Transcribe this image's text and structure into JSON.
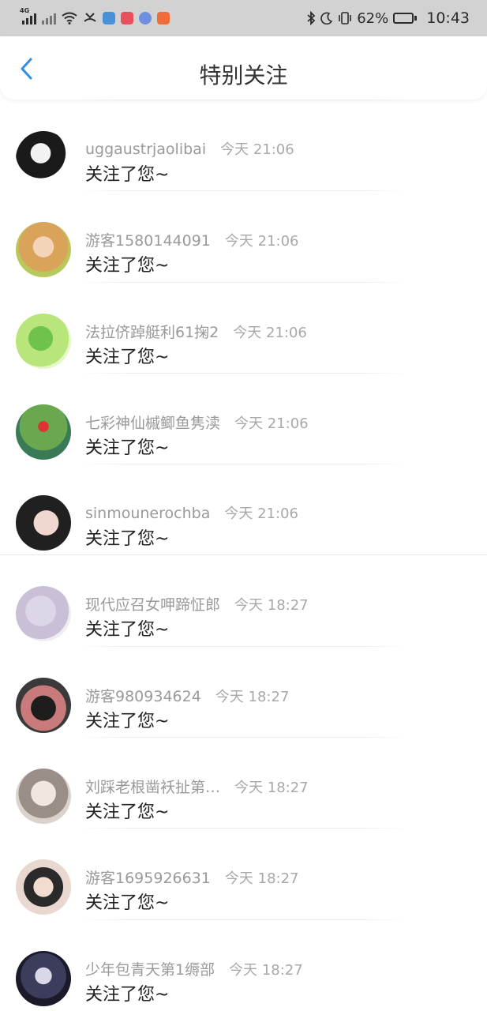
{
  "status_bar": {
    "network_label": "4G",
    "battery_percent": "62%",
    "battery_level": 0.62,
    "time": "10:43",
    "app_icon_colors": [
      "#4a90d9",
      "#e8505b",
      "#6f8ee0",
      "#f26b3a"
    ]
  },
  "header": {
    "title": "特别关注",
    "back_icon": "chevron-left-icon",
    "accent_color": "#2f8fe6"
  },
  "notifications": [
    {
      "name": "uggaustrjaolibai",
      "time": "今天 21:06",
      "message": "关注了您~"
    },
    {
      "name": "游客1580144091",
      "time": "今天 21:06",
      "message": "关注了您~"
    },
    {
      "name": "法拉侪踔艇利61掬2",
      "time": "今天 21:06",
      "message": "关注了您~"
    },
    {
      "name": "七彩神仙槭鲫鱼隽渎",
      "time": "今天 21:06",
      "message": "关注了您~"
    },
    {
      "name": "sinmounerochba",
      "time": "今天 21:06",
      "message": "关注了您~"
    },
    {
      "name": "现代应召女呷蹄怔郎",
      "time": "今天 18:27",
      "message": "关注了您~"
    },
    {
      "name": "游客980934624",
      "time": "今天 18:27",
      "message": "关注了您~"
    },
    {
      "name": "刘踩老根凿袄扯第…",
      "time": "今天 18:27",
      "message": "关注了您~"
    },
    {
      "name": "游客1695926631",
      "time": "今天 18:27",
      "message": "关注了您~"
    },
    {
      "name": "少年包青天第1缛部",
      "time": "今天 18:27",
      "message": "关注了您~"
    }
  ]
}
